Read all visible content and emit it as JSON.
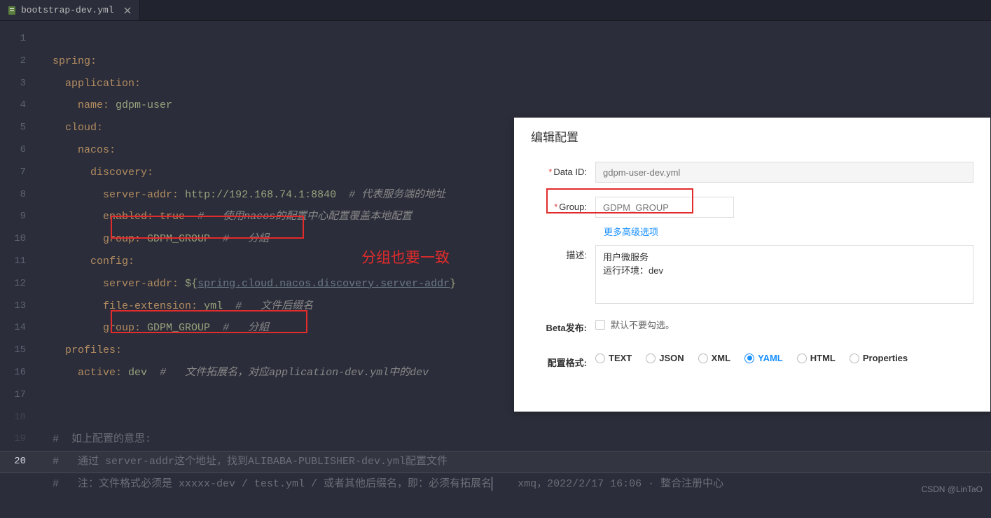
{
  "tab": {
    "name": "bootstrap-dev.yml"
  },
  "code": {
    "l1": "spring",
    "l2": "application",
    "l3k": "name",
    "l3v": "gdpm-user",
    "l4": "cloud",
    "l5": "nacos",
    "l6": "discovery",
    "l7k": "server-addr",
    "l7v": "http://192.168.74.1:8840",
    "l7c": "# 代表服务端的地址",
    "l8k": "enabled",
    "l8v": "true",
    "l8c": "#   使用nacos的配置中心配置覆盖本地配置",
    "l9k": "group",
    "l9v": "GDPM_GROUP",
    "l9c": "#   分組",
    "l10": "config",
    "l11k": "server-addr",
    "l11v": "${",
    "l11l": "spring.cloud.nacos.discovery.server-addr",
    "l11e": "}",
    "l12k": "file-extension",
    "l12v": "yml",
    "l12c": "#   文件后缀名",
    "l13k": "group",
    "l13v": "GDPM_GROUP",
    "l13c": "#   分組",
    "l14": "profiles",
    "l15k": "active",
    "l15v": "dev",
    "l15c": "#   文件拓展名，对应application-dev.yml中的dev",
    "l18": "#  如上配置的意思:",
    "l19": "#   通过 server-addr这个地址，找到ALIBABA-PUBLISHER-dev.yml配置文件",
    "l20a": "#   注：文件格式必须是 xxxxx-dev / test.yml / 或者其他后缀名，即：必须有拓展名",
    "l20b": "  xmq，2022/2/17 16:06 · 整合注册中心"
  },
  "annotation": "分组也要一致",
  "panel": {
    "title": "编辑配置",
    "dataId_label": "Data ID:",
    "dataId_value": "gdpm-user-dev.yml",
    "group_label": "Group:",
    "group_value": "GDPM_GROUP",
    "more": "更多高级选项",
    "desc_label": "描述:",
    "desc_value": "用户微服务\n运行环境：dev",
    "beta_label": "Beta发布:",
    "beta_hint": "默认不要勾选。",
    "format_label": "配置格式:",
    "formats": [
      "TEXT",
      "JSON",
      "XML",
      "YAML",
      "HTML",
      "Properties"
    ]
  },
  "watermark": "CSDN @LinTaO"
}
